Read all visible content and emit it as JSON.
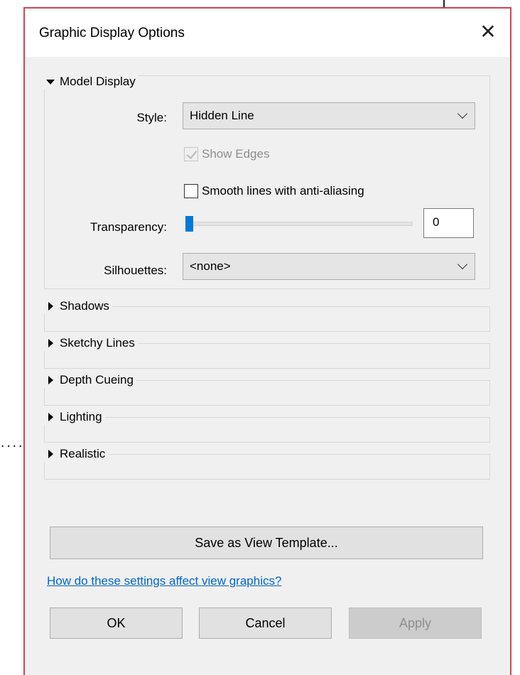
{
  "dialog": {
    "title": "Graphic Display Options",
    "close_glyph": "✕"
  },
  "model_display": {
    "header": "Model Display",
    "style_label": "Style:",
    "style_value": "Hidden Line",
    "show_edges_label": "Show Edges",
    "show_edges_checked": true,
    "show_edges_enabled": false,
    "smooth_lines_label": "Smooth lines with anti-aliasing",
    "smooth_lines_checked": false,
    "transparency_label": "Transparency:",
    "transparency_value": "0",
    "transparency_level": 0,
    "silhouettes_label": "Silhouettes:",
    "silhouettes_value": "<none>"
  },
  "sections": [
    {
      "label": "Shadows"
    },
    {
      "label": "Sketchy Lines"
    },
    {
      "label": "Depth Cueing"
    },
    {
      "label": "Lighting"
    },
    {
      "label": "Realistic"
    }
  ],
  "buttons": {
    "save_template": "Save as View Template...",
    "help_link": "How do these settings affect view graphics?",
    "ok": "OK",
    "cancel": "Cancel",
    "apply": "Apply"
  },
  "colors": {
    "accent": "#0078d7",
    "link": "#0066cc",
    "border_highlight": "#d04455"
  },
  "background": {
    "dots": "····"
  }
}
